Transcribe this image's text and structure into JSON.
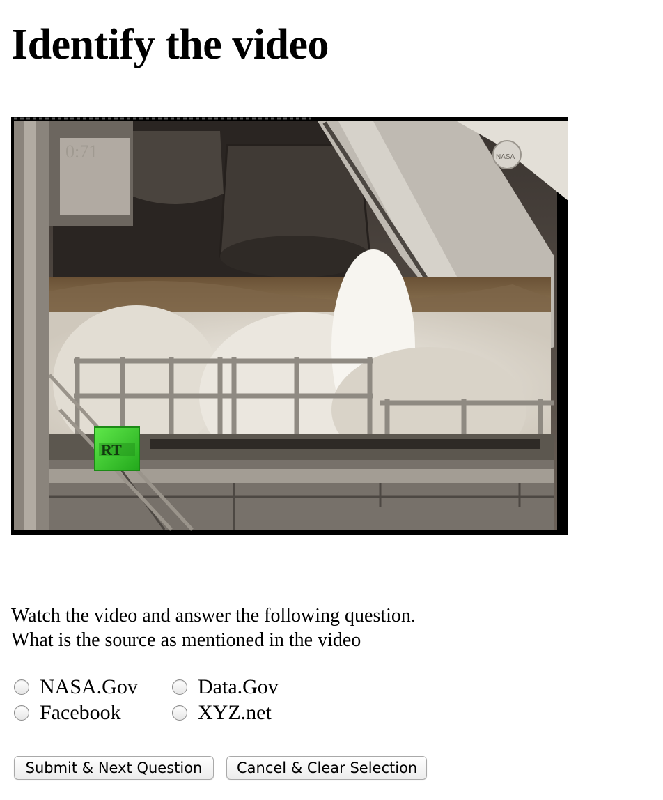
{
  "page": {
    "title": "Identify the video"
  },
  "video": {
    "watermark_logo": "RT",
    "overlay_text": "0:71",
    "corner_logo_text": "NASA"
  },
  "question": {
    "instruction": "Watch the video and answer the following question.",
    "prompt": "What is the source as mentioned in the video"
  },
  "options": [
    {
      "label": "NASA.Gov"
    },
    {
      "label": "Data.Gov"
    },
    {
      "label": "Facebook"
    },
    {
      "label": "XYZ.net"
    }
  ],
  "buttons": {
    "submit": "Submit & Next Question",
    "cancel": "Cancel & Clear Selection"
  },
  "colors": {
    "logo_green": "#3fce2f",
    "page_background": "#ffffff"
  }
}
